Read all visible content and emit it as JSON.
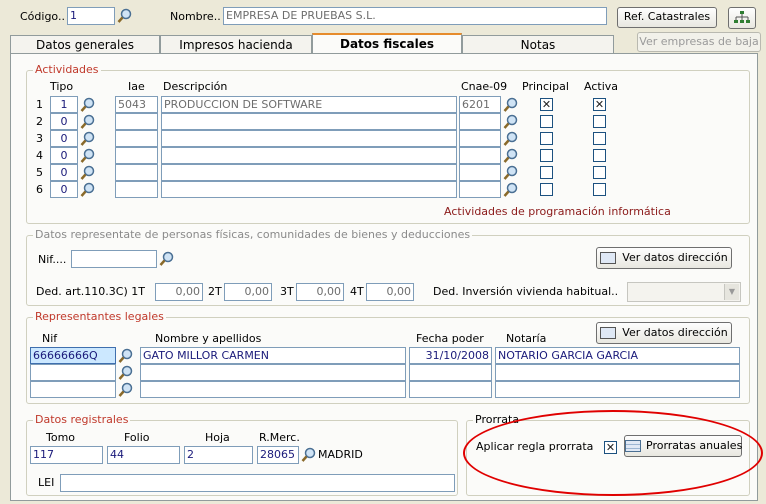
{
  "header": {
    "codigo_label": "Código..",
    "codigo_value": "1",
    "nombre_label": "Nombre..",
    "nombre_value": "EMPRESA DE PRUEBAS S.L.",
    "ref_catastrales_label": "Ref. Catastrales",
    "ver_empresas_baja_label": "Ver empresas de baja"
  },
  "tabs": [
    {
      "label": "Datos generales",
      "active": false
    },
    {
      "label": "Impresos hacienda",
      "active": false
    },
    {
      "label": "Datos fiscales",
      "active": true
    },
    {
      "label": "Notas",
      "active": false
    }
  ],
  "actividades": {
    "title": "Actividades",
    "columns": {
      "tipo": "Tipo",
      "iae": "Iae",
      "descripcion": "Descripción",
      "cnae": "Cnae-09",
      "principal": "Principal",
      "activa": "Activa"
    },
    "rows": [
      {
        "num": "1",
        "tipo": "1",
        "iae": "5043",
        "descripcion": "PRODUCCION DE SOFTWARE",
        "cnae": "6201",
        "principal": true,
        "activa": true
      },
      {
        "num": "2",
        "tipo": "0",
        "iae": "",
        "descripcion": "",
        "cnae": "",
        "principal": false,
        "activa": false
      },
      {
        "num": "3",
        "tipo": "0",
        "iae": "",
        "descripcion": "",
        "cnae": "",
        "principal": false,
        "activa": false
      },
      {
        "num": "4",
        "tipo": "0",
        "iae": "",
        "descripcion": "",
        "cnae": "",
        "principal": false,
        "activa": false
      },
      {
        "num": "5",
        "tipo": "0",
        "iae": "",
        "descripcion": "",
        "cnae": "",
        "principal": false,
        "activa": false
      },
      {
        "num": "6",
        "tipo": "0",
        "iae": "",
        "descripcion": "",
        "cnae": "",
        "principal": false,
        "activa": false
      }
    ],
    "cnae_description": "Actividades de programación informática"
  },
  "representante": {
    "title": "Datos representate de personas físicas, comunidades de bienes y deducciones",
    "nif_label": "Nif....",
    "nif_value": "",
    "ver_datos_direccion_label": "Ver datos dirección",
    "ded_label": "Ded. art.110.3C) 1T",
    "t1": "0,00",
    "t2_label": "2T",
    "t2": "0,00",
    "t3_label": "3T",
    "t3": "0,00",
    "t4_label": "4T",
    "t4": "0,00",
    "ded_vivienda_label": "Ded. Inversión vivienda habitual..",
    "ded_vivienda_value": ""
  },
  "legales": {
    "title": "Representantes legales",
    "columns": {
      "nif": "Nif",
      "nombre": "Nombre y apellidos",
      "fecha": "Fecha poder",
      "notaria": "Notaría"
    },
    "ver_datos_direccion_label": "Ver datos dirección",
    "rows": [
      {
        "nif": "66666666Q",
        "nombre": "GATO MILLOR CARMEN",
        "fecha": "31/10/2008",
        "notaria": "NOTARIO GARCIA GARCIA"
      },
      {
        "nif": "",
        "nombre": "",
        "fecha": "",
        "notaria": ""
      },
      {
        "nif": "",
        "nombre": "",
        "fecha": "",
        "notaria": ""
      }
    ]
  },
  "registrales": {
    "title": "Datos registrales",
    "tomo_label": "Tomo",
    "tomo_value": "117",
    "folio_label": "Folio",
    "folio_value": "44",
    "hoja_label": "Hoja",
    "hoja_value": "2",
    "rmerc_label": "R.Merc.",
    "rmerc_value": "28065",
    "rmerc_city": "MADRID",
    "lei_label": "LEI",
    "lei_value": ""
  },
  "prorrata": {
    "title": "Prorrata",
    "aplicar_label": "Aplicar regla prorrata",
    "aplicar_checked": true,
    "prorratas_anuales_label": "Prorratas anuales"
  },
  "colors": {
    "red_title": "#c0392b",
    "highlight_ellipse": "#e00000",
    "input_border": "#7f9db9"
  }
}
